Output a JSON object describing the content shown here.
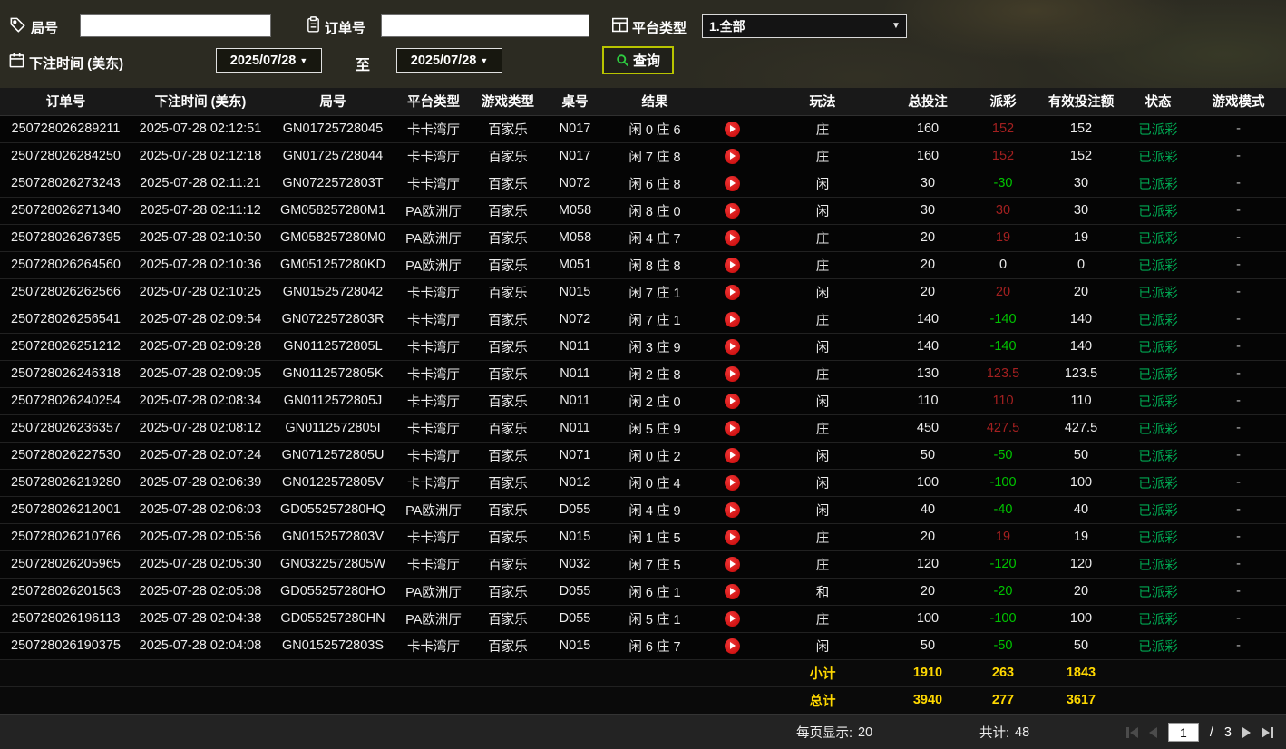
{
  "filters": {
    "round_label": "局号",
    "order_label": "订单号",
    "platform_label": "平台类型",
    "platform_value": "1.全部",
    "bet_time_label": "下注时间 (美东)",
    "to_label": "至",
    "date_from": "2025/07/28",
    "date_to": "2025/07/28",
    "query_label": "查询"
  },
  "table": {
    "headers": [
      "订单号",
      "下注时间 (美东)",
      "局号",
      "平台类型",
      "游戏类型",
      "桌号",
      "结果",
      "玩法",
      "总投注",
      "派彩",
      "有效投注额",
      "状态",
      "游戏模式"
    ],
    "rows": [
      {
        "order_no": "250728026289211",
        "bet_time": "2025-07-28 02:12:51",
        "round_no": "GN01725728045",
        "platform": "卡卡湾厅",
        "game_type": "百家乐",
        "table_no": "N017",
        "result": "闲 0 庄 6",
        "bet_side": "庄",
        "total_bet": "160",
        "payout": "152",
        "payout_color": "red",
        "valid_bet": "152",
        "status": "已派彩",
        "mode": "-"
      },
      {
        "order_no": "250728026284250",
        "bet_time": "2025-07-28 02:12:18",
        "round_no": "GN01725728044",
        "platform": "卡卡湾厅",
        "game_type": "百家乐",
        "table_no": "N017",
        "result": "闲 7 庄 8",
        "bet_side": "庄",
        "total_bet": "160",
        "payout": "152",
        "payout_color": "red",
        "valid_bet": "152",
        "status": "已派彩",
        "mode": "-"
      },
      {
        "order_no": "250728026273243",
        "bet_time": "2025-07-28 02:11:21",
        "round_no": "GN0722572803T",
        "platform": "卡卡湾厅",
        "game_type": "百家乐",
        "table_no": "N072",
        "result": "闲 6 庄 8",
        "bet_side": "闲",
        "total_bet": "30",
        "payout": "-30",
        "payout_color": "green",
        "valid_bet": "30",
        "status": "已派彩",
        "mode": "-"
      },
      {
        "order_no": "250728026271340",
        "bet_time": "2025-07-28 02:11:12",
        "round_no": "GM058257280M1",
        "platform": "PA欧洲厅",
        "game_type": "百家乐",
        "table_no": "M058",
        "result": "闲 8 庄 0",
        "bet_side": "闲",
        "total_bet": "30",
        "payout": "30",
        "payout_color": "red",
        "valid_bet": "30",
        "status": "已派彩",
        "mode": "-"
      },
      {
        "order_no": "250728026267395",
        "bet_time": "2025-07-28 02:10:50",
        "round_no": "GM058257280M0",
        "platform": "PA欧洲厅",
        "game_type": "百家乐",
        "table_no": "M058",
        "result": "闲 4 庄 7",
        "bet_side": "庄",
        "total_bet": "20",
        "payout": "19",
        "payout_color": "red",
        "valid_bet": "19",
        "status": "已派彩",
        "mode": "-"
      },
      {
        "order_no": "250728026264560",
        "bet_time": "2025-07-28 02:10:36",
        "round_no": "GM051257280KD",
        "platform": "PA欧洲厅",
        "game_type": "百家乐",
        "table_no": "M051",
        "result": "闲 8 庄 8",
        "bet_side": "庄",
        "total_bet": "20",
        "payout": "0",
        "payout_color": "white",
        "valid_bet": "0",
        "status": "已派彩",
        "mode": "-"
      },
      {
        "order_no": "250728026262566",
        "bet_time": "2025-07-28 02:10:25",
        "round_no": "GN01525728042",
        "platform": "卡卡湾厅",
        "game_type": "百家乐",
        "table_no": "N015",
        "result": "闲 7 庄 1",
        "bet_side": "闲",
        "total_bet": "20",
        "payout": "20",
        "payout_color": "red",
        "valid_bet": "20",
        "status": "已派彩",
        "mode": "-"
      },
      {
        "order_no": "250728026256541",
        "bet_time": "2025-07-28 02:09:54",
        "round_no": "GN0722572803R",
        "platform": "卡卡湾厅",
        "game_type": "百家乐",
        "table_no": "N072",
        "result": "闲 7 庄 1",
        "bet_side": "庄",
        "total_bet": "140",
        "payout": "-140",
        "payout_color": "green",
        "valid_bet": "140",
        "status": "已派彩",
        "mode": "-"
      },
      {
        "order_no": "250728026251212",
        "bet_time": "2025-07-28 02:09:28",
        "round_no": "GN0112572805L",
        "platform": "卡卡湾厅",
        "game_type": "百家乐",
        "table_no": "N011",
        "result": "闲 3 庄 9",
        "bet_side": "闲",
        "total_bet": "140",
        "payout": "-140",
        "payout_color": "green",
        "valid_bet": "140",
        "status": "已派彩",
        "mode": "-"
      },
      {
        "order_no": "250728026246318",
        "bet_time": "2025-07-28 02:09:05",
        "round_no": "GN0112572805K",
        "platform": "卡卡湾厅",
        "game_type": "百家乐",
        "table_no": "N011",
        "result": "闲 2 庄 8",
        "bet_side": "庄",
        "total_bet": "130",
        "payout": "123.5",
        "payout_color": "red",
        "valid_bet": "123.5",
        "status": "已派彩",
        "mode": "-"
      },
      {
        "order_no": "250728026240254",
        "bet_time": "2025-07-28 02:08:34",
        "round_no": "GN0112572805J",
        "platform": "卡卡湾厅",
        "game_type": "百家乐",
        "table_no": "N011",
        "result": "闲 2 庄 0",
        "bet_side": "闲",
        "total_bet": "110",
        "payout": "110",
        "payout_color": "red",
        "valid_bet": "110",
        "status": "已派彩",
        "mode": "-"
      },
      {
        "order_no": "250728026236357",
        "bet_time": "2025-07-28 02:08:12",
        "round_no": "GN0112572805I",
        "platform": "卡卡湾厅",
        "game_type": "百家乐",
        "table_no": "N011",
        "result": "闲 5 庄 9",
        "bet_side": "庄",
        "total_bet": "450",
        "payout": "427.5",
        "payout_color": "red",
        "valid_bet": "427.5",
        "status": "已派彩",
        "mode": "-"
      },
      {
        "order_no": "250728026227530",
        "bet_time": "2025-07-28 02:07:24",
        "round_no": "GN0712572805U",
        "platform": "卡卡湾厅",
        "game_type": "百家乐",
        "table_no": "N071",
        "result": "闲 0 庄 2",
        "bet_side": "闲",
        "total_bet": "50",
        "payout": "-50",
        "payout_color": "green",
        "valid_bet": "50",
        "status": "已派彩",
        "mode": "-"
      },
      {
        "order_no": "250728026219280",
        "bet_time": "2025-07-28 02:06:39",
        "round_no": "GN0122572805V",
        "platform": "卡卡湾厅",
        "game_type": "百家乐",
        "table_no": "N012",
        "result": "闲 0 庄 4",
        "bet_side": "闲",
        "total_bet": "100",
        "payout": "-100",
        "payout_color": "green",
        "valid_bet": "100",
        "status": "已派彩",
        "mode": "-"
      },
      {
        "order_no": "250728026212001",
        "bet_time": "2025-07-28 02:06:03",
        "round_no": "GD055257280HQ",
        "platform": "PA欧洲厅",
        "game_type": "百家乐",
        "table_no": "D055",
        "result": "闲 4 庄 9",
        "bet_side": "闲",
        "total_bet": "40",
        "payout": "-40",
        "payout_color": "green",
        "valid_bet": "40",
        "status": "已派彩",
        "mode": "-"
      },
      {
        "order_no": "250728026210766",
        "bet_time": "2025-07-28 02:05:56",
        "round_no": "GN0152572803V",
        "platform": "卡卡湾厅",
        "game_type": "百家乐",
        "table_no": "N015",
        "result": "闲 1 庄 5",
        "bet_side": "庄",
        "total_bet": "20",
        "payout": "19",
        "payout_color": "red",
        "valid_bet": "19",
        "status": "已派彩",
        "mode": "-"
      },
      {
        "order_no": "250728026205965",
        "bet_time": "2025-07-28 02:05:30",
        "round_no": "GN0322572805W",
        "platform": "卡卡湾厅",
        "game_type": "百家乐",
        "table_no": "N032",
        "result": "闲 7 庄 5",
        "bet_side": "庄",
        "total_bet": "120",
        "payout": "-120",
        "payout_color": "green",
        "valid_bet": "120",
        "status": "已派彩",
        "mode": "-"
      },
      {
        "order_no": "250728026201563",
        "bet_time": "2025-07-28 02:05:08",
        "round_no": "GD055257280HO",
        "platform": "PA欧洲厅",
        "game_type": "百家乐",
        "table_no": "D055",
        "result": "闲 6 庄 1",
        "bet_side": "和",
        "total_bet": "20",
        "payout": "-20",
        "payout_color": "green",
        "valid_bet": "20",
        "status": "已派彩",
        "mode": "-"
      },
      {
        "order_no": "250728026196113",
        "bet_time": "2025-07-28 02:04:38",
        "round_no": "GD055257280HN",
        "platform": "PA欧洲厅",
        "game_type": "百家乐",
        "table_no": "D055",
        "result": "闲 5 庄 1",
        "bet_side": "庄",
        "total_bet": "100",
        "payout": "-100",
        "payout_color": "green",
        "valid_bet": "100",
        "status": "已派彩",
        "mode": "-"
      },
      {
        "order_no": "250728026190375",
        "bet_time": "2025-07-28 02:04:08",
        "round_no": "GN0152572803S",
        "platform": "卡卡湾厅",
        "game_type": "百家乐",
        "table_no": "N015",
        "result": "闲 6 庄 7",
        "bet_side": "闲",
        "total_bet": "50",
        "payout": "-50",
        "payout_color": "green",
        "valid_bet": "50",
        "status": "已派彩",
        "mode": "-"
      }
    ]
  },
  "summary": {
    "subtotal_label": "小计",
    "subtotal_total_bet": "1910",
    "subtotal_payout": "263",
    "subtotal_valid_bet": "1843",
    "total_label": "总计",
    "total_total_bet": "3940",
    "total_payout": "277",
    "total_valid_bet": "3617"
  },
  "pagination": {
    "per_page_label": "每页显示:",
    "per_page_value": "20",
    "total_label": "共计:",
    "total_value": "48",
    "current_page": "1",
    "separator": "/",
    "total_pages": "3"
  },
  "colors": {
    "payout_win": "#a32020",
    "payout_loss": "#00c300",
    "status_paid": "#00a651",
    "summary_highlight": "#ffd800",
    "query_border": "#b8c400"
  }
}
